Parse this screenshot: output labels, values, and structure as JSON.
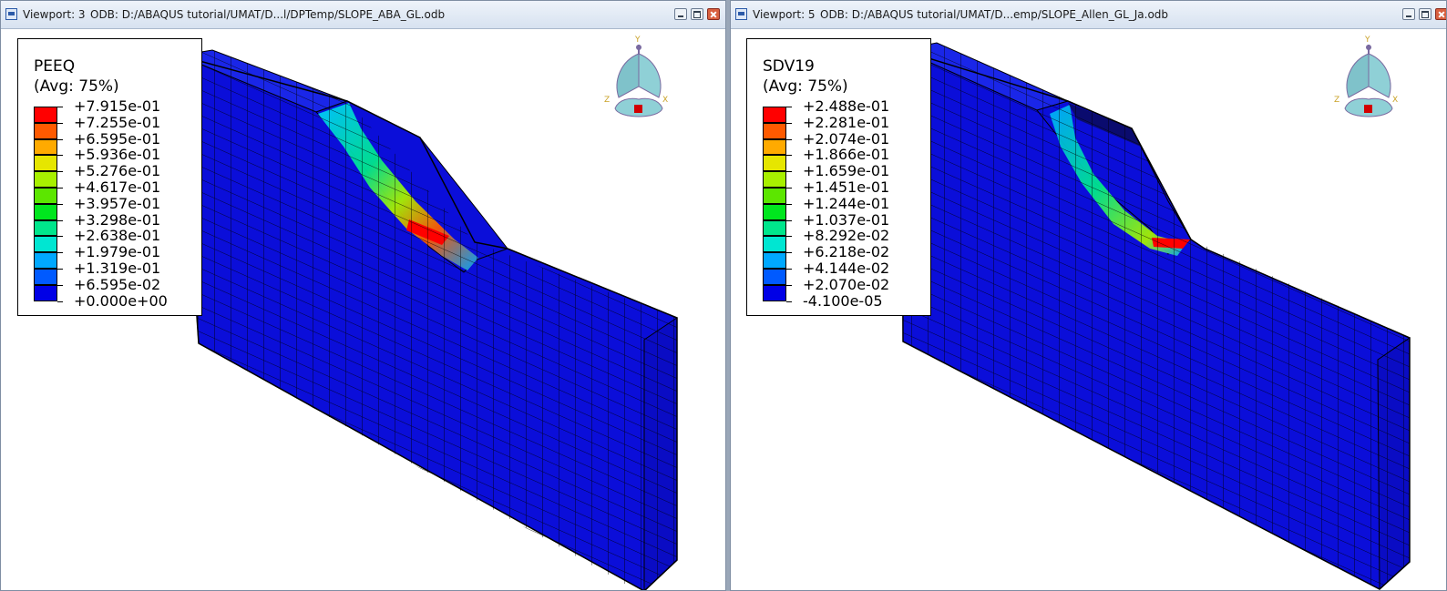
{
  "viewports": [
    {
      "title": "Viewport: 3",
      "odb": "ODB: D:/ABAQUS tutorial/UMAT/D...l/DPTemp/SLOPE_ABA_GL.odb",
      "legend": {
        "variable": "PEEQ",
        "averaging": "(Avg: 75%)",
        "values": [
          "+7.915e-01",
          "+7.255e-01",
          "+6.595e-01",
          "+5.936e-01",
          "+5.276e-01",
          "+4.617e-01",
          "+3.957e-01",
          "+3.298e-01",
          "+2.638e-01",
          "+1.979e-01",
          "+1.319e-01",
          "+6.595e-02",
          "+0.000e+00"
        ]
      }
    },
    {
      "title": "Viewport: 5",
      "odb": "ODB: D:/ABAQUS tutorial/UMAT/D...emp/SLOPE_Allen_GL_Ja.odb",
      "legend": {
        "variable": "SDV19",
        "averaging": "(Avg: 75%)",
        "values": [
          "+2.488e-01",
          "+2.281e-01",
          "+2.074e-01",
          "+1.866e-01",
          "+1.659e-01",
          "+1.451e-01",
          "+1.244e-01",
          "+1.037e-01",
          "+8.292e-02",
          "+6.218e-02",
          "+4.144e-02",
          "+2.070e-02",
          "-4.100e-05"
        ]
      }
    }
  ],
  "legend_colors": [
    "#ff0000",
    "#ff5a00",
    "#ffaa00",
    "#e6e600",
    "#a8f000",
    "#5ce600",
    "#00e61e",
    "#00e68c",
    "#00e6d2",
    "#00a8ff",
    "#005aff",
    "#0000e6"
  ],
  "triad": {
    "y": "Y",
    "z": "Z",
    "x": "X"
  },
  "colors": {
    "model_blue": "#0b0ed9",
    "mesh_line": "#000000",
    "triad_body": "#7fc2ca"
  }
}
